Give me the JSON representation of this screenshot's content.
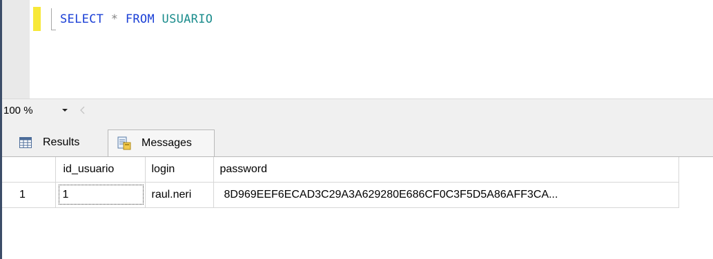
{
  "editor": {
    "query": {
      "kw_select": "SELECT",
      "op_star": "*",
      "kw_from": "FROM",
      "table": "USUARIO"
    }
  },
  "zoom": {
    "value": "100 %"
  },
  "tabs": [
    {
      "label": "Results",
      "icon": "grid-icon"
    },
    {
      "label": "Messages",
      "icon": "messages-icon"
    }
  ],
  "results": {
    "columns": [
      "id_usuario",
      "login",
      "password"
    ],
    "rows": [
      {
        "row_number": "1",
        "id_usuario": "1",
        "login": "raul.neri",
        "password": "8D969EEF6ECAD3C29A3A629280E686CF0C3F5D5A86AFF3CA..."
      }
    ]
  },
  "colors": {
    "keyword": "#1a3fd6",
    "identifier": "#1a8c8c",
    "change_marker": "#f7e838"
  }
}
